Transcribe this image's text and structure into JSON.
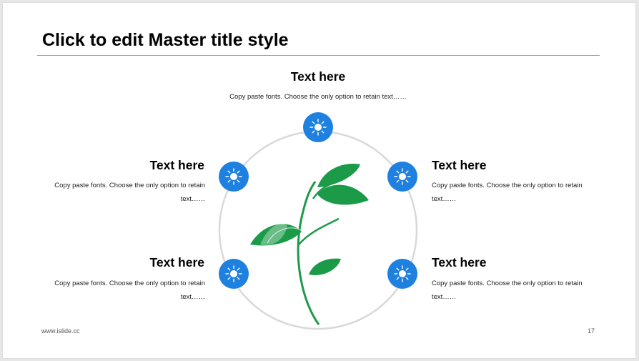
{
  "slide": {
    "title": "Click to edit Master title style",
    "footer_url": "www.islide.cc",
    "page_number": "17"
  },
  "items": [
    {
      "heading": "Text here",
      "text": "Copy paste fonts. Choose the only option to retain text……"
    },
    {
      "heading": "Text here",
      "text": "Copy paste fonts. Choose the only option to retain text……"
    },
    {
      "heading": "Text here",
      "text": "Copy paste fonts. Choose the only option to retain text……"
    },
    {
      "heading": "Text here",
      "text": "Copy paste fonts. Choose the only option to retain text……"
    },
    {
      "heading": "Text here",
      "text": "Copy paste fonts. Choose the only option to retain text……"
    }
  ],
  "icons": [
    "sun-icon",
    "sun-icon",
    "sun-icon",
    "sun-icon",
    "sun-icon",
    "plant-illustration"
  ],
  "colors": {
    "badge_blue": "#1e80df",
    "leaf_green": "#1b9a48",
    "circle_gray": "#d9d9d9",
    "rule_gray": "#9a9a9a"
  }
}
